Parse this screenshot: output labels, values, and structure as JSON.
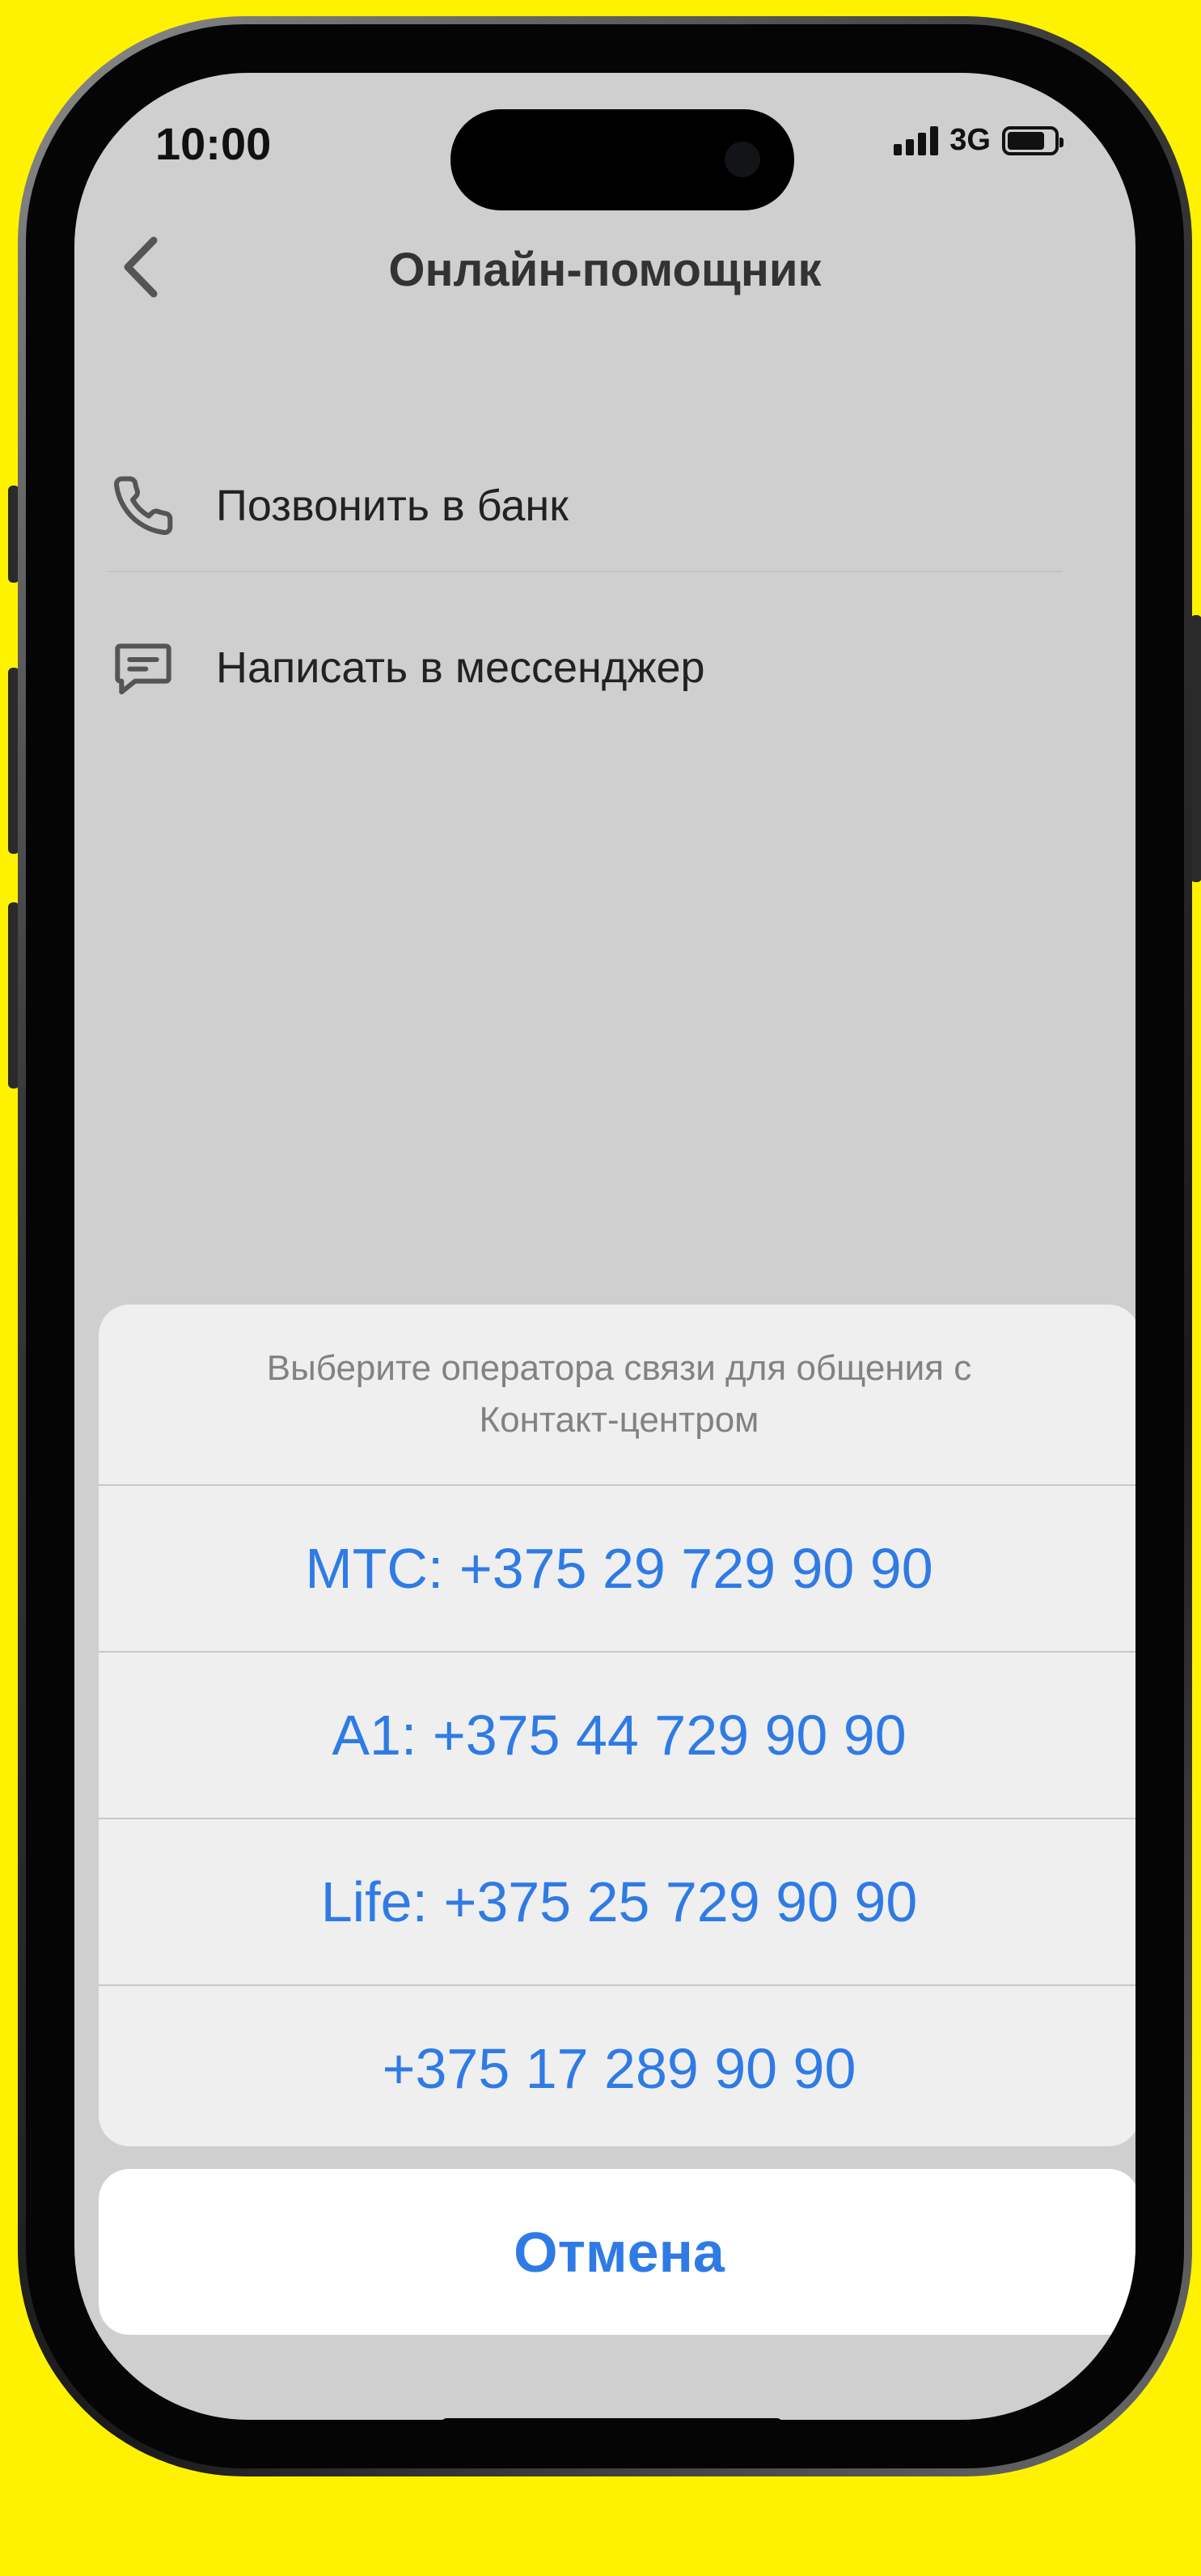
{
  "status_bar": {
    "time": "10:00",
    "network": "3G",
    "signal_bars": 4,
    "battery_level": 0.8
  },
  "nav": {
    "back_icon": "chevron-left-icon",
    "title": "Онлайн-помощник"
  },
  "menu": {
    "items": [
      {
        "icon": "phone-icon",
        "label": "Позвонить в банк"
      },
      {
        "icon": "chat-icon",
        "label": "Написать в мессенджер"
      }
    ]
  },
  "action_sheet": {
    "title": "Выберите оператора связи для общения с\nКонтакт-центром",
    "options": [
      {
        "label": "МТС: +375 29 729 90 90"
      },
      {
        "label": "А1: +375 44 729 90 90"
      },
      {
        "label": "Life: +375 25 729 90 90"
      },
      {
        "label": "+375 17 289 90 90"
      }
    ],
    "cancel_label": "Отмена"
  },
  "colors": {
    "page_background": "#FFF200",
    "screen_background": "#CFCFCF",
    "accent_blue": "#2F7BE5",
    "sheet_background": "#EFEFEF"
  }
}
